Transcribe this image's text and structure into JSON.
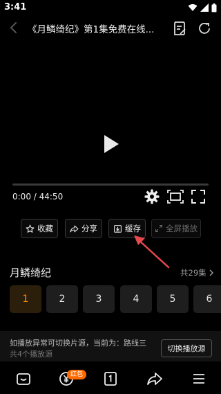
{
  "status_bar": {
    "time": "3:41"
  },
  "header": {
    "title": "《月鳞绮纪》第1集免费在线..."
  },
  "player": {
    "time_display": "0:00 / 44:50",
    "progress": 0
  },
  "actions": [
    {
      "label": "收藏",
      "icon": "star-icon"
    },
    {
      "label": "分享",
      "icon": "share-icon"
    },
    {
      "label": "缓存",
      "icon": "download-icon"
    },
    {
      "label": "全屏播放",
      "icon": "expand-icon",
      "disabled": true
    }
  ],
  "series": {
    "title": "月鳞绮纪",
    "count_label": "共29集",
    "episodes": [
      "1",
      "2",
      "3",
      "4",
      "5",
      "6"
    ],
    "active_episode": "1"
  },
  "source": {
    "hint": "如播放异常可切换片源，当前为：路线三",
    "count": "共4个播放源",
    "switch_label": "切换播放源"
  },
  "bottom_nav": {
    "badge": "红包"
  },
  "colors": {
    "accent": "#ff8a00",
    "arrow": "#e5484d"
  }
}
